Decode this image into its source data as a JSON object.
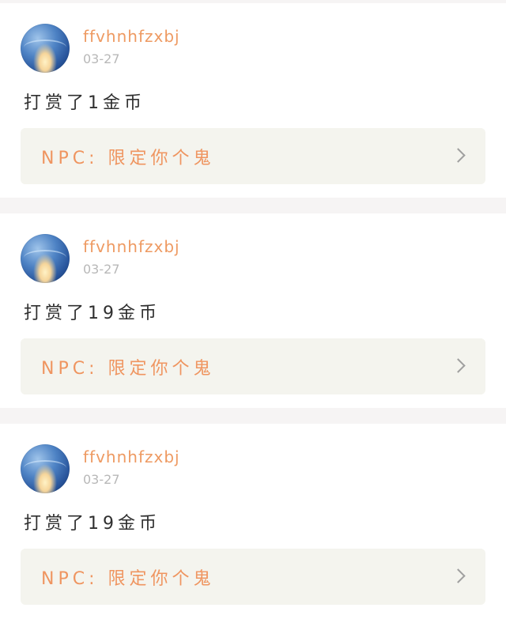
{
  "posts": [
    {
      "username": "ffvhnhfzxbj",
      "date": "03-27",
      "message": "打赏了1金币",
      "link_text": "NPC: 限定你个鬼"
    },
    {
      "username": "ffvhnhfzxbj",
      "date": "03-27",
      "message": "打赏了19金币",
      "link_text": "NPC: 限定你个鬼"
    },
    {
      "username": "ffvhnhfzxbj",
      "date": "03-27",
      "message": "打赏了19金币",
      "link_text": "NPC: 限定你个鬼"
    }
  ],
  "colors": {
    "username": "#ee9a62",
    "link_text": "#ef9560",
    "link_box": "#f4f4ee",
    "divider": "#f6f4f4"
  },
  "icons": {
    "chevron": "chevron-right-icon",
    "avatar": "avatar"
  }
}
